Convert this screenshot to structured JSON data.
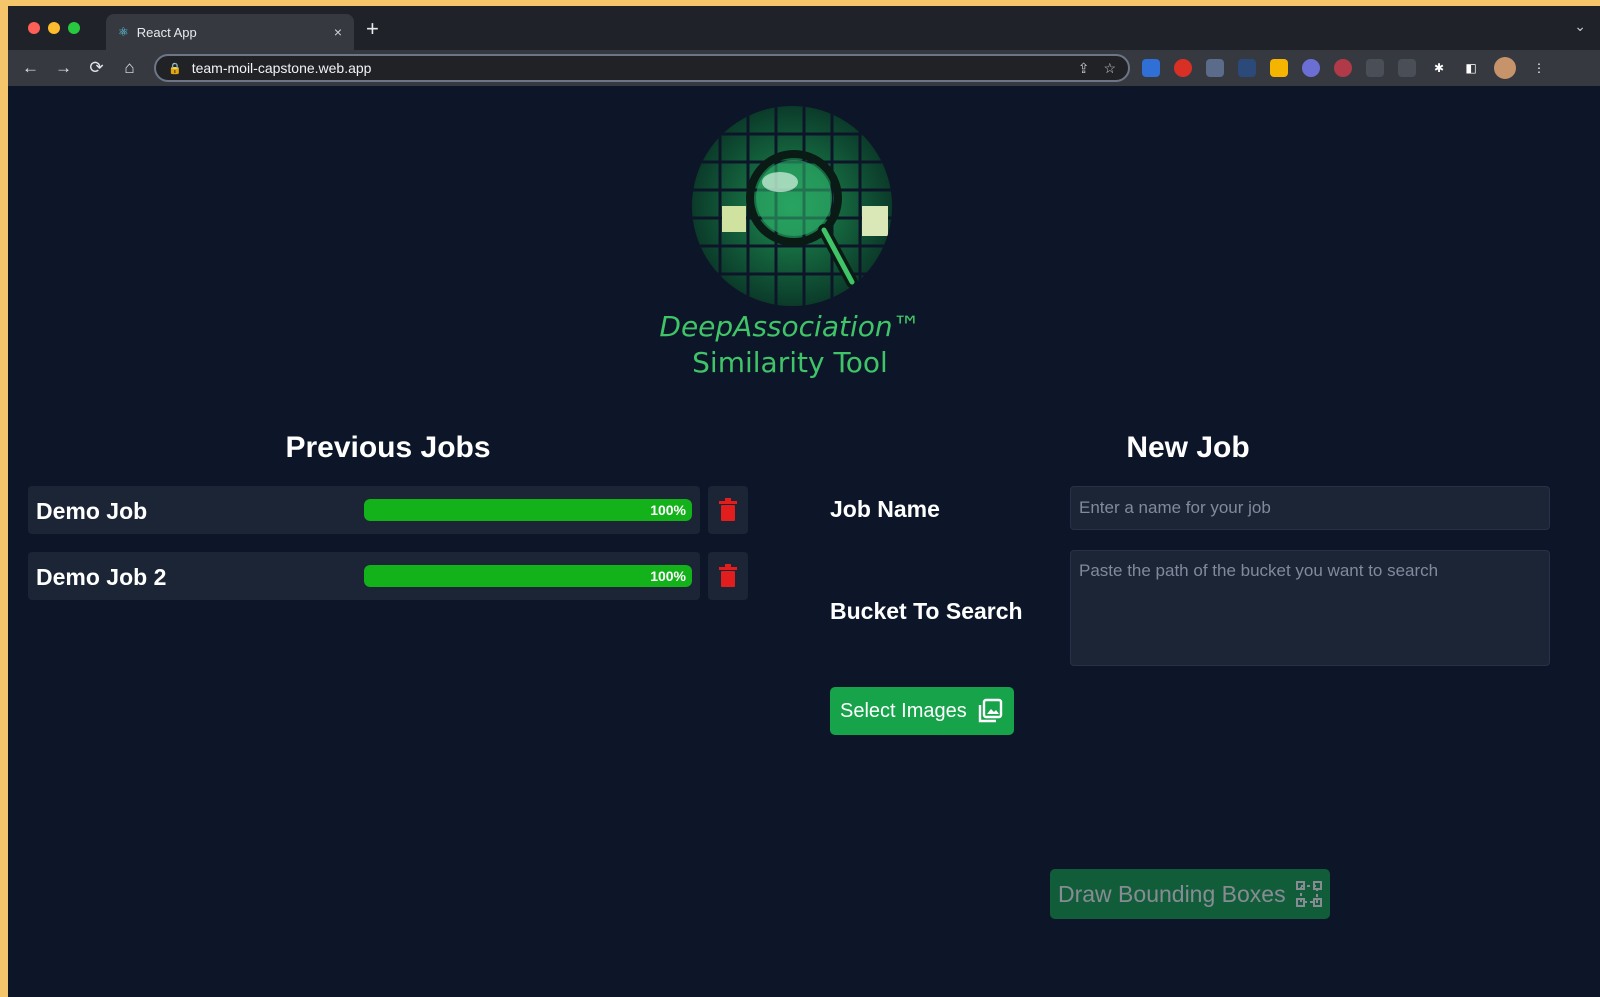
{
  "browser": {
    "tab_title": "React App",
    "tab_close": "×",
    "new_tab": "+",
    "tab_menu": "⌄",
    "url": "team-moil-capstone.web.app",
    "nav": {
      "back": "←",
      "forward": "→",
      "reload": "⟳",
      "home": "⌂"
    },
    "omnibox_icons": {
      "share": "⇪",
      "bookmark": "☆"
    }
  },
  "app": {
    "brand": "DeepAssociation™",
    "subtitle": "Similarity Tool",
    "accent_color": "#3fc468"
  },
  "previous_jobs": {
    "title": "Previous Jobs",
    "jobs": [
      {
        "name": "Demo Job",
        "progress": 100,
        "progress_label": "100%"
      },
      {
        "name": "Demo Job 2",
        "progress": 100,
        "progress_label": "100%"
      }
    ]
  },
  "new_job": {
    "title": "New Job",
    "job_name_label": "Job Name",
    "job_name_placeholder": "Enter a name for your job",
    "bucket_label": "Bucket To Search",
    "bucket_placeholder": "Paste the path of the bucket you want to search",
    "select_images_label": "Select Images",
    "draw_boxes_label": "Draw Bounding Boxes"
  }
}
